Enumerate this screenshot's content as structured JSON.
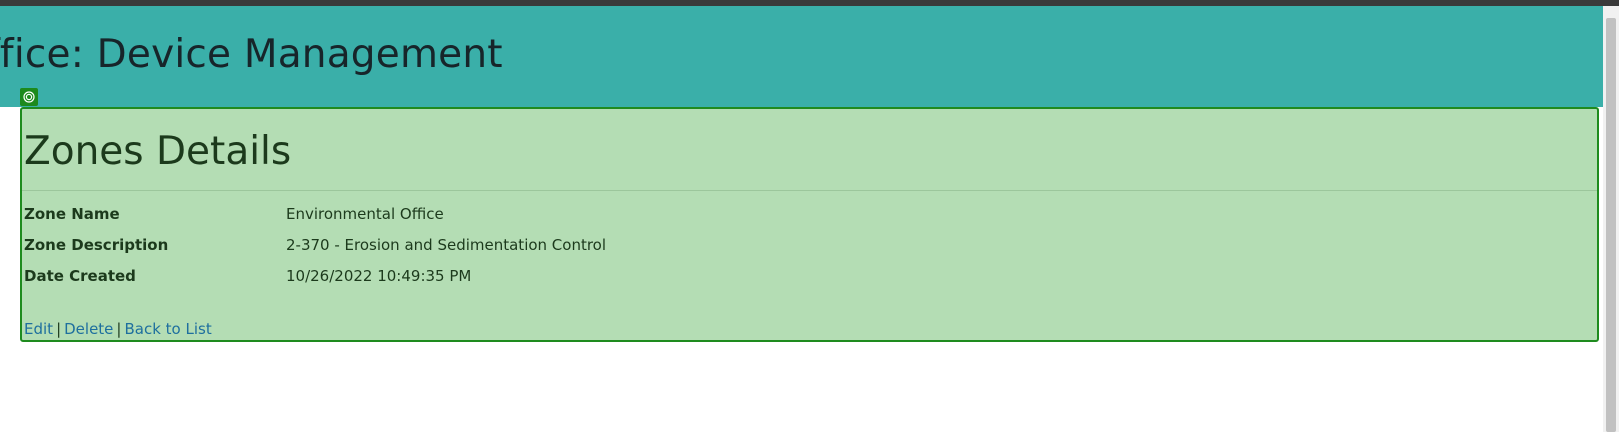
{
  "header": {
    "title": "ffice: Device Management"
  },
  "page": {
    "heading": "Zones Details"
  },
  "details": [
    {
      "label": "Zone Name",
      "value": "Environmental Office"
    },
    {
      "label": "Zone Description",
      "value": "2-370 - Erosion and Sedimentation Control"
    },
    {
      "label": "Date Created",
      "value": "10/26/2022 10:49:35 PM"
    }
  ],
  "actions": {
    "edit": "Edit",
    "delete": "Delete",
    "back": "Back to List",
    "separator": "|"
  },
  "colors": {
    "header_bg": "#3aafa9",
    "panel_bg": "#b4ddb4",
    "panel_border": "#1e8b1e",
    "link": "#1e6f9e"
  },
  "icons": {
    "selection_badge": "target-icon"
  }
}
